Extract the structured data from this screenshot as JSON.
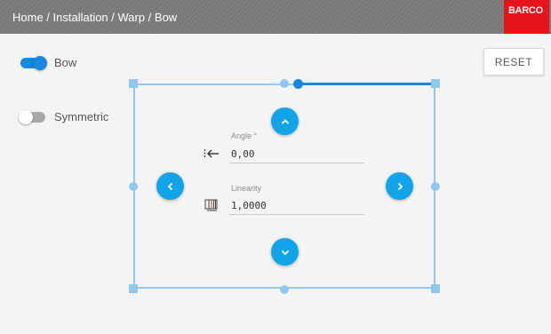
{
  "header": {
    "breadcrumb": "Home / Installation / Warp / Bow",
    "logo_text": "BARCO"
  },
  "toggles": [
    {
      "label": "Bow",
      "on": true
    },
    {
      "label": "Symmetric",
      "on": false
    }
  ],
  "reset_button": {
    "label": "RESET"
  },
  "fields": [
    {
      "label": "Angle °",
      "value": "0,00",
      "icon": "arrow-left-bar-icon"
    },
    {
      "label": "Linearity",
      "value": "1,0000",
      "icon": "linearity-icon"
    }
  ],
  "nav_buttons": [
    "chevron-up-icon",
    "chevron-left-icon",
    "chevron-right-icon",
    "chevron-down-icon"
  ],
  "colors": {
    "header_bg": "#787878",
    "logo_bg": "#e8141b",
    "accent": "#1a86de",
    "frame": "#90c8f4",
    "nav_button": "#11a4e8",
    "background": "#f4f4f4"
  }
}
